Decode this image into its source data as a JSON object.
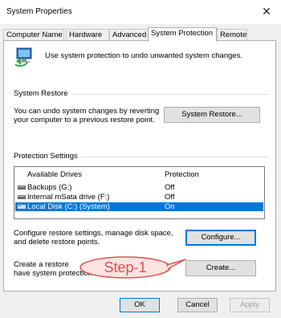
{
  "window": {
    "title": "System Properties"
  },
  "tabs": [
    {
      "label": "Computer Name"
    },
    {
      "label": "Hardware"
    },
    {
      "label": "Advanced"
    },
    {
      "label": "System Protection",
      "active": true
    },
    {
      "label": "Remote"
    }
  ],
  "intro": {
    "text": "Use system protection to undo unwanted system changes."
  },
  "system_restore": {
    "group_title": "System Restore",
    "description_line1": "You can undo system changes by reverting",
    "description_line2": "your computer to a previous restore point.",
    "button": "System Restore..."
  },
  "protection": {
    "group_title": "Protection Settings",
    "columns": {
      "drive": "Available Drives",
      "protection": "Protection"
    },
    "drives": [
      {
        "name": "Backups (G:)",
        "status": "Off",
        "icon": "drive-icon"
      },
      {
        "name": "Internal mSata drive (F:)",
        "status": "Off",
        "icon": "drive-icon"
      },
      {
        "name": "Local Disk (C:) (System)",
        "status": "On",
        "icon": "system-drive-icon",
        "selected": true
      }
    ],
    "configure_line1": "Configure restore settings, manage disk space,",
    "configure_line2": "and delete restore points.",
    "configure_button": "Configure...",
    "create_line1": "Create a restore",
    "create_line2": "have system protection",
    "create_button": "Create..."
  },
  "annotation": {
    "text": "Step-1",
    "color": "#d9534f"
  },
  "footer": {
    "ok": "OK",
    "cancel": "Cancel",
    "apply": "Apply"
  },
  "colors": {
    "selection": "#0078d7",
    "accent": "#0078d7"
  }
}
